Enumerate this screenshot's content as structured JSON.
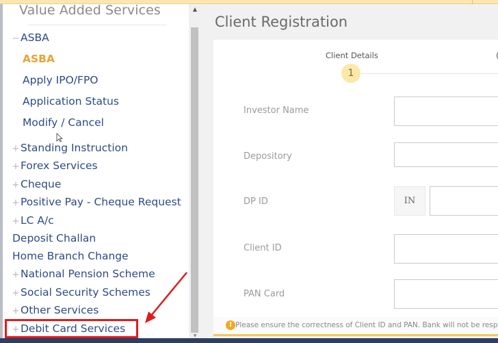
{
  "sidebar": {
    "title": "Value Added Services",
    "items": [
      {
        "label": "ASBA",
        "prefix": "−",
        "level": "group-open"
      },
      {
        "label": "ASBA",
        "prefix": "",
        "level": "sub",
        "active": true
      },
      {
        "label": "Apply IPO/FPO",
        "prefix": "",
        "level": "sub"
      },
      {
        "label": "Application Status",
        "prefix": "",
        "level": "sub"
      },
      {
        "label": "Modify / Cancel",
        "prefix": "",
        "level": "sub"
      },
      {
        "label": "Standing Instruction",
        "prefix": "+",
        "level": "group"
      },
      {
        "label": "Forex Services",
        "prefix": "+",
        "level": "group"
      },
      {
        "label": "Cheque",
        "prefix": "+",
        "level": "group"
      },
      {
        "label": "Positive Pay - Cheque Request",
        "prefix": "+",
        "level": "group"
      },
      {
        "label": "LC A/c",
        "prefix": "+",
        "level": "group"
      },
      {
        "label": "Deposit Challan",
        "prefix": "",
        "level": "link"
      },
      {
        "label": "Home Branch Change",
        "prefix": "",
        "level": "link"
      },
      {
        "label": "National Pension Scheme",
        "prefix": "+",
        "level": "group"
      },
      {
        "label": "Social Security Schemes",
        "prefix": "+",
        "level": "group"
      },
      {
        "label": "Other Services",
        "prefix": "+",
        "level": "group"
      },
      {
        "label": "Debit Card Services",
        "prefix": "+",
        "level": "group",
        "highlighted": true
      }
    ]
  },
  "main": {
    "page_title": "Client Registration",
    "stepper": {
      "current_step_label": "Client Details",
      "current_step_number": "1",
      "next_step_label_partial": "("
    },
    "form": {
      "investor_name": {
        "label": "Investor Name",
        "value": ""
      },
      "depository": {
        "label": "Depository",
        "value": ""
      },
      "dp_id": {
        "label": "DP ID",
        "prefix": "IN",
        "value": ""
      },
      "client_id": {
        "label": "Client ID",
        "value": ""
      },
      "pan_card": {
        "label": "PAN Card",
        "value": ""
      }
    },
    "notice": {
      "icon": "!",
      "text": "Please ensure the correctness of Client ID and PAN. Bank will not be responsible"
    }
  },
  "colors": {
    "menu_text": "#2e4a86",
    "menu_active": "#f0a030",
    "step_circle": "#fde8a8",
    "notice_icon": "#f5a623",
    "annotation": "#e21a1a",
    "banner": "#fce7b2"
  },
  "scrollbar": {
    "up": "▲",
    "down": "▼"
  }
}
